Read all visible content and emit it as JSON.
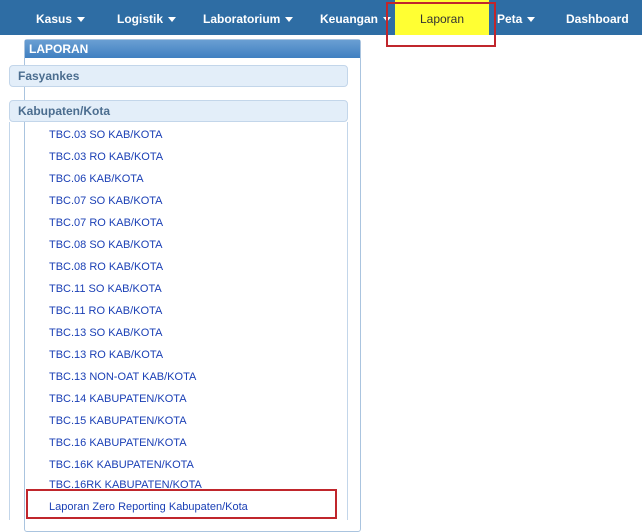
{
  "nav": {
    "kasus": "Kasus",
    "logistik": "Logistik",
    "laboratorium": "Laboratorium",
    "keuangan": "Keuangan",
    "laporan": "Laporan",
    "peta": "Peta",
    "dashboard": "Dashboard",
    "active_color": "#ffff33"
  },
  "panel": {
    "title": "LAPORAN",
    "section_fasyankes": "Fasyankes",
    "section_kabkota": "Kabupaten/Kota",
    "links": [
      "TBC.03 SO KAB/KOTA",
      "TBC.03 RO KAB/KOTA",
      "TBC.06 KAB/KOTA",
      "TBC.07 SO KAB/KOTA",
      "TBC.07 RO KAB/KOTA",
      "TBC.08 SO KAB/KOTA",
      "TBC.08 RO KAB/KOTA",
      "TBC.11 SO KAB/KOTA",
      "TBC.11 RO KAB/KOTA",
      "TBC.13 SO KAB/KOTA",
      "TBC.13 RO KAB/KOTA",
      "TBC.13 NON-OAT KAB/KOTA",
      "TBC.14 KABUPATEN/KOTA",
      "TBC.15 KABUPATEN/KOTA",
      "TBC.16 KABUPATEN/KOTA",
      "TBC.16K KABUPATEN/KOTA",
      "TBC.16RK KABUPATEN/KOTA",
      "Laporan Zero Reporting Kabupaten/Kota"
    ]
  },
  "colors": {
    "navbar": "#2e6da4",
    "highlight": "#c0262c",
    "link": "#1a3fb5"
  }
}
